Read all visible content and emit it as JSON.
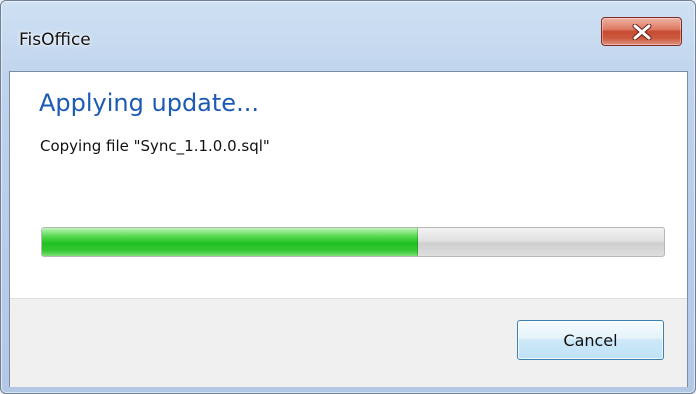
{
  "window": {
    "title": "FisOffice",
    "close_icon": "close-x-icon"
  },
  "dialog": {
    "heading": "Applying update...",
    "status": "Copying file \"Sync_1.1.0.0.sql\"",
    "progress_fraction": 0.605,
    "cancel_label": "Cancel"
  },
  "colors": {
    "heading": "#1c5ab5",
    "progress_green": "#1fbf22",
    "close_red": "#c64a32"
  }
}
